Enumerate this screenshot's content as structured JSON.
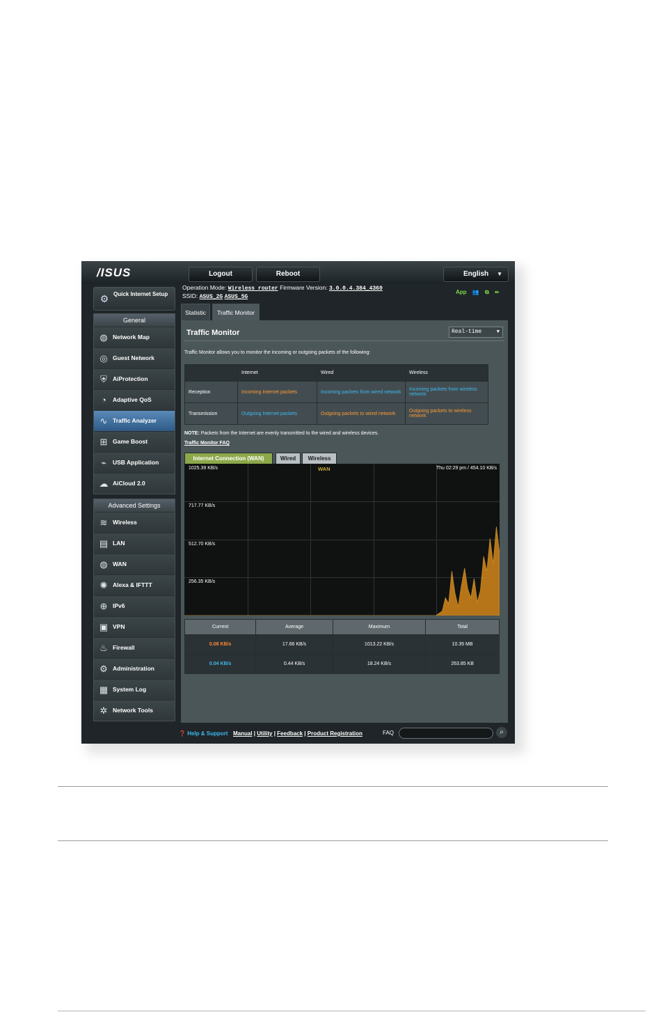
{
  "topbar": {
    "logo": "/ISUS",
    "logout": "Logout",
    "reboot": "Reboot",
    "language": "English"
  },
  "qis": {
    "label": "Quick Internet Setup"
  },
  "sidebar": {
    "general_header": "General",
    "general_items": [
      {
        "label": "Network Map",
        "icon": "globe-icon"
      },
      {
        "label": "Guest Network",
        "icon": "guest-globe-icon"
      },
      {
        "label": "AiProtection",
        "icon": "shield-lock-icon"
      },
      {
        "label": "Adaptive QoS",
        "icon": "gauge-icon"
      },
      {
        "label": "Traffic Analyzer",
        "icon": "wave-icon",
        "active": true
      },
      {
        "label": "Game Boost",
        "icon": "gamepad-icon"
      },
      {
        "label": "USB Application",
        "icon": "usb-icon"
      },
      {
        "label": "AiCloud 2.0",
        "icon": "cloud-icon"
      }
    ],
    "advanced_header": "Advanced Settings",
    "advanced_items": [
      {
        "label": "Wireless",
        "icon": "wifi-icon"
      },
      {
        "label": "LAN",
        "icon": "lan-icon"
      },
      {
        "label": "WAN",
        "icon": "wan-globe-icon"
      },
      {
        "label": "Alexa & IFTTT",
        "icon": "alexa-icon"
      },
      {
        "label": "IPv6",
        "icon": "ipv6-icon"
      },
      {
        "label": "VPN",
        "icon": "vpn-icon"
      },
      {
        "label": "Firewall",
        "icon": "fire-icon"
      },
      {
        "label": "Administration",
        "icon": "admin-icon"
      },
      {
        "label": "System Log",
        "icon": "log-icon"
      },
      {
        "label": "Network Tools",
        "icon": "tools-icon"
      }
    ]
  },
  "header": {
    "op_mode_label": "Operation Mode:",
    "op_mode": "Wireless router",
    "fw_label": "Firmware Version:",
    "fw": "3.0.0.4.384_4360",
    "ssid_label": "SSID:",
    "ssid1": "ASUS_2G",
    "ssid2": "ASUS_5G",
    "app": "App"
  },
  "tabs": {
    "statistic": "Statistic",
    "traffic_monitor": "Traffic Monitor"
  },
  "main": {
    "title": "Traffic Monitor",
    "mode": "Real-time",
    "description": "Traffic Monitor allows you to monitor the incoming or outgoing packets of the following:",
    "table": {
      "headers": [
        "",
        "Internet",
        "Wired",
        "Wireless"
      ],
      "rows": [
        {
          "label": "Reception",
          "internet": "Incoming Internet packets",
          "wired": "Incoming packets from wired network",
          "wireless": "Incoming packets from wireless network"
        },
        {
          "label": "Transmission",
          "internet": "Outgoing Internet packets",
          "wired": "Outgoing packets to wired network",
          "wireless": "Outgoing packets to wireless network"
        }
      ]
    },
    "note_label": "NOTE:",
    "note": "Packets from the Internet are evenly transmitted to the wired and wireless devices.",
    "faq": "Traffic Monitor FAQ",
    "chart_tabs": [
      "Internet Connection (WAN)",
      "Wired",
      "Wireless"
    ]
  },
  "chart_data": {
    "type": "area",
    "title": "WAN",
    "readout": "Thu 02:29 pm / 454.10 KB/s",
    "y_ticks": [
      "1025.39 KB/s",
      "717.77 KB/s",
      "512.70 KB/s",
      "256.35 KB/s"
    ],
    "ylim": [
      0,
      1025.39
    ],
    "grid": true,
    "series": [
      {
        "color": "#c8801a",
        "values": [
          0,
          0,
          0,
          0,
          0,
          0,
          0,
          0,
          0,
          0,
          0,
          0,
          0,
          0,
          0,
          0,
          0,
          0,
          0,
          0,
          0,
          0,
          0,
          0,
          0,
          0,
          0,
          0,
          0,
          0,
          0,
          0,
          0,
          0,
          0,
          0,
          0,
          0,
          0,
          0,
          0,
          0,
          0,
          0,
          0,
          0,
          0,
          0,
          0,
          0,
          0,
          0,
          0,
          0,
          0,
          0,
          0,
          0,
          0,
          0,
          0,
          0,
          0,
          0,
          0,
          0,
          0,
          0,
          0,
          0,
          0,
          0,
          0,
          0,
          0,
          0,
          0,
          0,
          0,
          0,
          15,
          30,
          120,
          80,
          300,
          150,
          60,
          200,
          320,
          180,
          120,
          250,
          90,
          170,
          400,
          300,
          520,
          350,
          600,
          420
        ]
      }
    ]
  },
  "stats": {
    "headers": [
      "Current",
      "Average",
      "Maximum",
      "Total"
    ],
    "rows": [
      {
        "current": "0.08 KB/s",
        "average": "17.66 KB/s",
        "maximum": "1013.22 KB/s",
        "total": "10.35 MB",
        "color": "#ff8a33"
      },
      {
        "current": "0.04 KB/s",
        "average": "0.44 KB/s",
        "maximum": "18.24 KB/s",
        "total": "263.85 KB",
        "color": "#3fb8f0"
      }
    ]
  },
  "footer": {
    "help": "Help & Support",
    "links": [
      "Manual",
      "Utility",
      "Feedback",
      "Product Registration"
    ],
    "faq": "FAQ"
  }
}
